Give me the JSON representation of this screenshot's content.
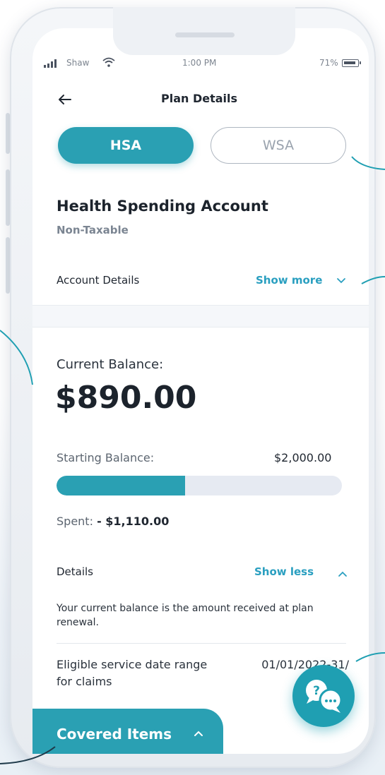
{
  "status_bar": {
    "carrier": "Shaw",
    "time": "1:00 PM",
    "battery": "71%"
  },
  "header": {
    "title": "Plan Details"
  },
  "tabs": [
    {
      "label": "HSA",
      "active": true
    },
    {
      "label": "WSA",
      "active": false
    }
  ],
  "account": {
    "title": "Health Spending Account",
    "subtitle": "Non-Taxable",
    "details_label": "Account Details",
    "show_more": "Show more"
  },
  "balance": {
    "label": "Current Balance:",
    "value": "$890.00",
    "starting_label": "Starting Balance:",
    "starting_value": "$2,000.00",
    "spent_label": "Spent:",
    "spent_value": "- $1,110.00",
    "spent_fraction": 0.45
  },
  "details": {
    "label": "Details",
    "show_less": "Show less",
    "note": "Your current balance is the amount received at plan renewal.",
    "eligible_label": "Eligible service date range for claims",
    "eligible_value": "01/01/2022-31/"
  },
  "covered": {
    "label": "Covered Items"
  },
  "colors": {
    "accent": "#2aa0b3",
    "link": "#2a9fc0",
    "text": "#1f2630"
  }
}
